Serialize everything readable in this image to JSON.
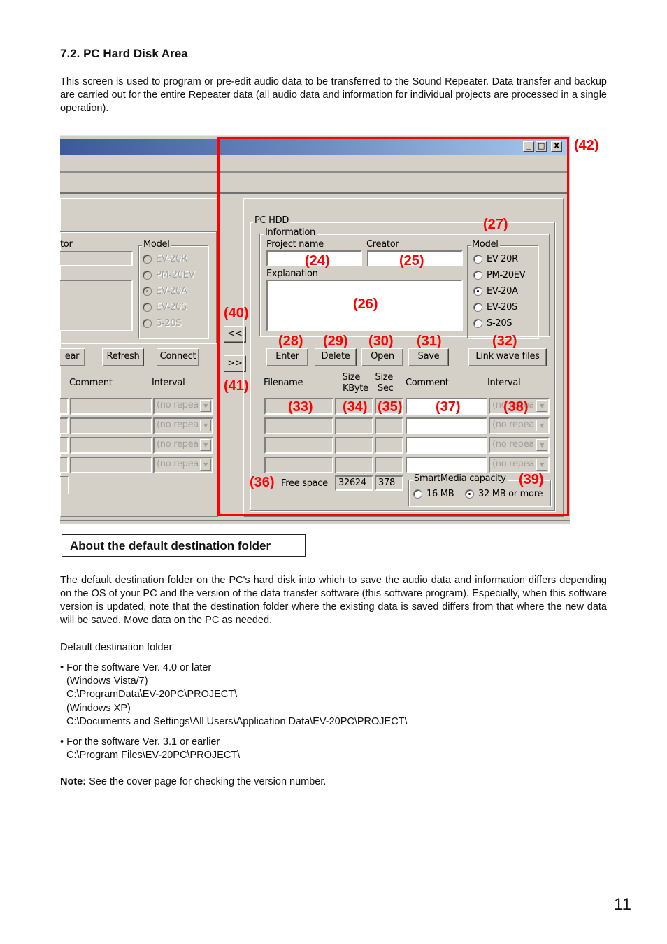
{
  "document": {
    "section_title": "7.2. PC Hard Disk Area",
    "intro": "This screen is used to program or pre-edit audio data to be transferred to the Sound Repeater. Data transfer and backup are carried out for the entire Repeater data (all audio data and information for individual projects are processed in a single operation).",
    "callout_title": "About the default destination folder",
    "callout_body": "The default destination folder on the PC's hard disk into which to save the audio data and information differs depending on the OS of your PC and the version of the data transfer software (this software program). Especially, when this software version is updated, note that the destination folder where the existing data is saved differs from that where the new data will be saved. Move data on the PC as needed.",
    "folder_heading": "Default destination folder",
    "bullets": [
      {
        "title": "• For the software Ver. 4.0 or later",
        "lines": [
          "(Windows Vista/7)",
          "C:\\ProgramData\\EV-20PC\\PROJECT\\",
          "(Windows XP)",
          "C:\\Documents and Settings\\All Users\\Application Data\\EV-20PC\\PROJECT\\"
        ]
      },
      {
        "title": "• For the software Ver. 3.1 or earlier",
        "lines": [
          "C:\\Program Files\\EV-20PC\\PROJECT\\"
        ]
      }
    ],
    "note_label": "Note:",
    "note_text": " See the cover page for checking the version number.",
    "page_number": "11"
  },
  "window": {
    "caption_buttons": [
      "_",
      "□",
      "X"
    ],
    "left_panel": {
      "creator_label_fragment": "tor",
      "model_group": "Model",
      "models": [
        "EV-20R",
        "PM-20EV",
        "EV-20A",
        "EV-20S",
        "S-20S"
      ],
      "selected_model": "EV-20A",
      "buttons": [
        "ear",
        "Refresh",
        "Connect"
      ],
      "columns": [
        "Comment",
        "Interval"
      ],
      "interval_value": "(no repea"
    },
    "transfer_buttons": {
      "to_left": "<<",
      "to_right": ">>"
    },
    "pc_hdd": {
      "group_title": "PC HDD",
      "info_group": "Information",
      "project_name_label": "Project name",
      "project_name_value": "",
      "creator_label": "Creator",
      "creator_value": "",
      "explanation_label": "Explanation",
      "explanation_value": "",
      "model_group": "Model",
      "models": [
        "EV-20R",
        "PM-20EV",
        "EV-20A",
        "EV-20S",
        "S-20S"
      ],
      "selected_model": "EV-20A",
      "buttons": {
        "enter": "Enter",
        "delete": "Delete",
        "open": "Open",
        "save": "Save",
        "link": "Link wave files"
      },
      "columns": {
        "filename": "Filename",
        "size_kbyte_1": "Size",
        "size_kbyte_2": "KByte",
        "size_sec_1": "Size",
        "size_sec_2": "Sec",
        "comment": "Comment",
        "interval": "Interval"
      },
      "rows": [
        {
          "filename": "",
          "kbyte": "",
          "sec": "",
          "comment": "",
          "interval": "(no repea"
        },
        {
          "filename": "",
          "kbyte": "",
          "sec": "",
          "comment": "",
          "interval": "(no repea"
        },
        {
          "filename": "",
          "kbyte": "",
          "sec": "",
          "comment": "",
          "interval": "(no repea"
        },
        {
          "filename": "",
          "kbyte": "",
          "sec": "",
          "comment": "",
          "interval": "(no repea"
        }
      ],
      "free_space_label": "Free space",
      "free_space_kbyte": "32624",
      "free_space_sec": "378",
      "smartmedia_group": "SmartMedia capacity",
      "smartmedia_options": [
        "16 MB",
        "32 MB or more"
      ],
      "smartmedia_selected": "32 MB or more"
    }
  },
  "annotations": {
    "n24": "(24)",
    "n25": "(25)",
    "n26": "(26)",
    "n27": "(27)",
    "n28": "(28)",
    "n29": "(29)",
    "n30": "(30)",
    "n31": "(31)",
    "n32": "(32)",
    "n33": "(33)",
    "n34": "(34)",
    "n35": "(35)",
    "n36": "(36)",
    "n37": "(37)",
    "n38": "(38)",
    "n39": "(39)",
    "n40": "(40)",
    "n41": "(41)",
    "n42": "(42)",
    "highlight_color": "#ff0000"
  }
}
